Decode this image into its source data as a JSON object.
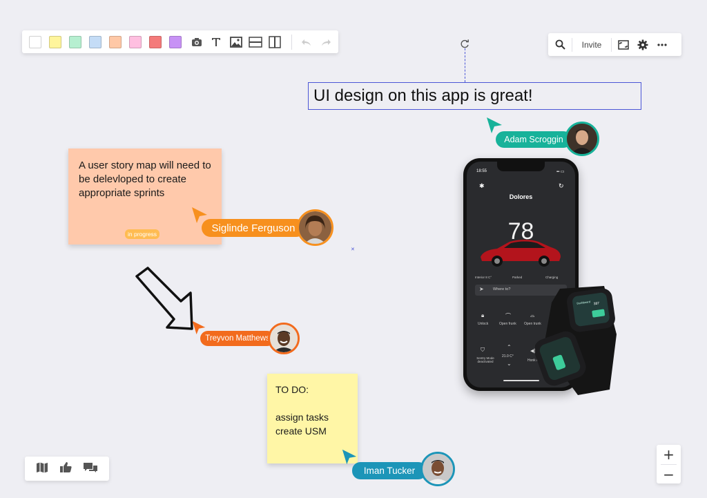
{
  "toolbar": {
    "swatches": [
      "#ffffff",
      "#fff59c",
      "#b6efd0",
      "#c4dcf6",
      "#ffc8a6",
      "#ffbfe0",
      "#f47a7a",
      "#c792f5"
    ],
    "tools": [
      "camera-icon",
      "text-icon",
      "image-icon",
      "horizontal-line-icon",
      "vertical-line-icon",
      "undo-icon",
      "redo-icon"
    ]
  },
  "topright": {
    "invite_label": "Invite"
  },
  "headline": {
    "text": "UI design on this app is great!"
  },
  "collaborators": {
    "adam": {
      "name": "Adam Scroggin",
      "color": "#17b29a"
    },
    "siglinde": {
      "name": "Siglinde Ferguson",
      "color": "#f7901e"
    },
    "treyvon": {
      "name": "Treyvon Matthews",
      "color": "#f26b1d"
    },
    "iman": {
      "name": "Iman Tucker",
      "color": "#1c95b8"
    }
  },
  "note_orange": {
    "text": "A user story map will need to be delevloped to create appropriate sprints",
    "tag": "in progress",
    "color": "#ffc9ab"
  },
  "note_yellow": {
    "line1": "TO DO:",
    "line2": "assign tasks",
    "line3": "create USM",
    "color": "#fff6a6"
  },
  "phone": {
    "time": "18:55",
    "name": "Dolores",
    "range": "78",
    "stat_interior": "Interior 8 C°",
    "stat_parked": "Parked",
    "stat_charging": "Charging",
    "search_placeholder": "Where to?",
    "actions": [
      "Unlock",
      "Open frunk",
      "Open trunk"
    ],
    "sentry": "Sentry Mode",
    "sentry_state": "deactivated",
    "temp": "21.0 C°",
    "honk": "Honk h"
  },
  "watch": {
    "label": "Dashboard",
    "value": "387"
  },
  "bottom_icons": [
    "map-icon",
    "thumbs-up-icon",
    "comments-icon"
  ],
  "zoom": {
    "in": "+",
    "out": "−"
  }
}
